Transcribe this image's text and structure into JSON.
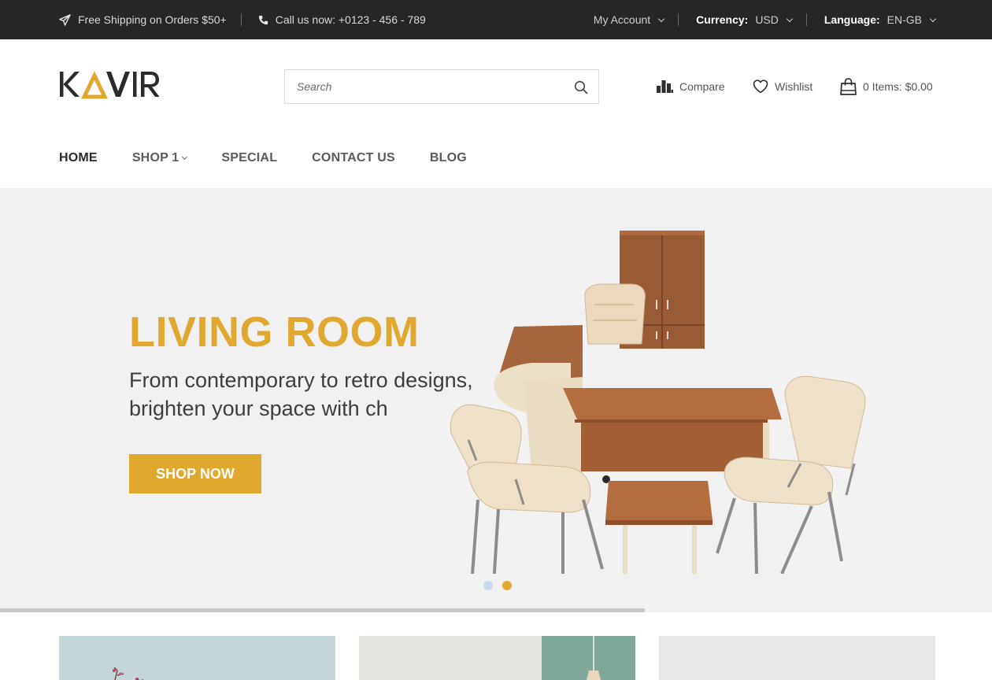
{
  "topbar": {
    "shipping_text": "Free Shipping on Orders $50+",
    "phone_text": "Call us now: +0123 - 456 - 789",
    "account_label": "My Account",
    "currency_label": "Currency:",
    "currency_value": "USD",
    "language_label": "Language:",
    "language_value": "EN-GB"
  },
  "header": {
    "logo_text": "KAVIR",
    "search_placeholder": "Search",
    "compare_label": "Compare",
    "wishlist_label": "Wishlist",
    "cart_label": "0 Items: $0.00"
  },
  "nav": {
    "items": [
      {
        "label": "HOME",
        "active": true
      },
      {
        "label": "SHOP 1",
        "dropdown": true
      },
      {
        "label": "SPECIAL"
      },
      {
        "label": "CONTACT US"
      },
      {
        "label": "BLOG"
      }
    ]
  },
  "hero": {
    "title": "LIVING ROOM",
    "subtitle_line1": "From contemporary to retro designs,",
    "subtitle_line2": "brighten your space with ch",
    "button_label": "SHOP NOW",
    "slides": 2,
    "active_slide": 2,
    "slide_progress": 0.65
  },
  "colors": {
    "accent": "#e0a82e",
    "topbar_bg": "#262626",
    "hero_bg": "#f1f1f1",
    "dot_inactive": "#c9daf0",
    "dot_active": "#e0a82e"
  },
  "icons": {
    "shipping": "paper-plane-icon",
    "phone": "phone-icon",
    "search": "search-icon",
    "compare": "bar-chart-icon",
    "wishlist": "heart-icon",
    "cart": "shopping-bag-icon"
  }
}
